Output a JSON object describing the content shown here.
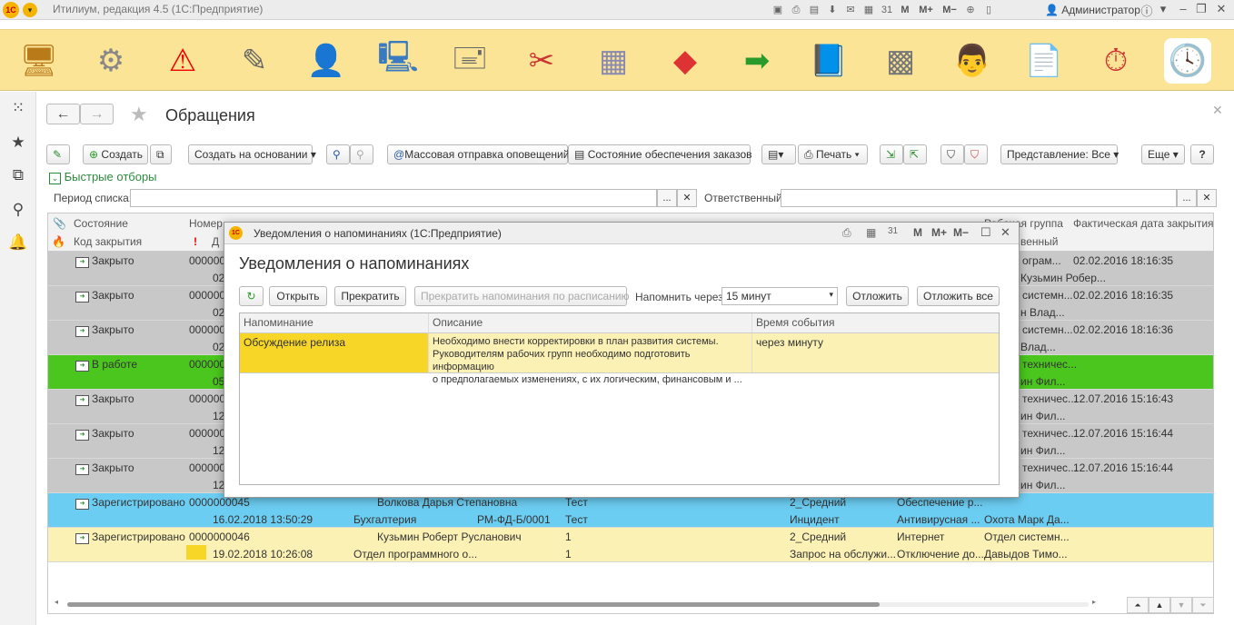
{
  "app": {
    "title": "Итилиум, редакция 4.5  (1С:Предприятие)",
    "user": "Администратор",
    "toolbar_icons": [
      "save-icon",
      "print-icon",
      "preview-icon",
      "download-icon",
      "mail-icon",
      "calendar-icon",
      "calendar31-icon"
    ],
    "memory_labels": {
      "m": "M",
      "mplus": "M+",
      "mminus": "M−"
    }
  },
  "sections": [
    "desktop-icon",
    "settings-icon",
    "warning-icon",
    "tools-icon",
    "contacts-icon",
    "computer-icon",
    "stamp-icon",
    "repair-icon",
    "cube-icon",
    "boxes-icon",
    "arrow-icon",
    "book-icon",
    "safe-icon",
    "finance-icon",
    "document-icon",
    "stopwatch-icon",
    "clock-icon"
  ],
  "page": {
    "title": "Обращения"
  },
  "toolbar": {
    "create": "Создать",
    "create_based": "Создать на основании",
    "mass_send": "Массовая отправка оповещений",
    "order_status": "Состояние обеспечения заказов",
    "print": "Печать",
    "view": "Представление: Все",
    "more": "Еще",
    "help": "?"
  },
  "filters": {
    "quick_filters": "Быстрые отборы",
    "period_label": "Период списка:",
    "responsible_label": "Ответственный:",
    "period_value": "",
    "responsible_value": ""
  },
  "grid": {
    "headers": {
      "status": "Состояние",
      "close_code": "Код закрытия",
      "number": "Номер",
      "date_short": "Д",
      "group": "Рабочая группа",
      "group_part": "венный",
      "close_date": "Фактическая дата закрытия"
    },
    "rows": [
      {
        "status": "Закрыто",
        "num": "000000",
        "sub": "02",
        "col1": "ограм...",
        "col2": "Кузьмин Робер...",
        "close": "02.02.2016 18:16:35",
        "color": "gray"
      },
      {
        "status": "Закрыто",
        "num": "000000",
        "sub": "02",
        "col1": "системн...",
        "col2": "н Влад...",
        "close": "02.02.2016 18:16:35",
        "color": "gray"
      },
      {
        "status": "Закрыто",
        "num": "000000",
        "sub": "02",
        "col1": "системн...",
        "col2": "Влад...",
        "close": "02.02.2016 18:16:36",
        "color": "gray"
      },
      {
        "status": "В работе",
        "num": "000000",
        "sub": "05",
        "col1": "техничес...",
        "col2": "ин Фил...",
        "close": "",
        "color": "green"
      },
      {
        "status": "Закрыто",
        "num": "000000",
        "sub": "12",
        "col1": "техничес...",
        "col2": "ин Фил...",
        "close": "12.07.2016 15:16:43",
        "color": "gray"
      },
      {
        "status": "Закрыто",
        "num": "000000",
        "sub": "12",
        "col1": "техничес...",
        "col2": "ин Фил...",
        "close": "12.07.2016 15:16:44",
        "color": "gray"
      },
      {
        "status": "Закрыто",
        "num": "000000",
        "sub": "12",
        "col1": "техничес...",
        "col2": "ин Фил...",
        "close": "12.07.2016 15:16:44",
        "color": "gray"
      }
    ],
    "blue_row": {
      "status": "Зарегистрировано",
      "num": "0000000045",
      "person": "Волкова Дарья Степановна",
      "subject": "Тест",
      "priority": "2_Средний",
      "service": "Обеспечение р...",
      "date": "16.02.2018 13:50:29",
      "dept": "Бухгалтерия",
      "workplace": "РМ-ФД-Б/0001",
      "desc": "Тест",
      "type": "Инцидент",
      "service2": "Антивирусная ...",
      "responsible": "Охота Марк Да..."
    },
    "yellow_row": {
      "status": "Зарегистрировано",
      "num": "0000000046",
      "person": "Кузьмин Роберт Русланович",
      "subject": "1",
      "priority": "2_Средний",
      "service": "Интернет",
      "group": "Отдел системн...",
      "date": "19.02.2018 10:26:08",
      "dept": "Отдел программного о...",
      "desc": "1",
      "type": "Запрос на обслужи...",
      "service2": "Отключение до...",
      "responsible": "Давыдов Тимо..."
    }
  },
  "dialog": {
    "window_title": "Уведомления о напоминаниях  (1С:Предприятие)",
    "heading": "Уведомления о напоминаниях",
    "open": "Открыть",
    "stop": "Прекратить",
    "stop_schedule": "Прекратить напоминания  по расписанию",
    "remind_label": "Напомнить через:",
    "remind_value": "15 минут",
    "postpone": "Отложить",
    "postpone_all": "Отложить все",
    "columns": {
      "reminder": "Напоминание",
      "description": "Описание",
      "event_time": "Время события"
    },
    "row": {
      "reminder": "Обсуждение релиза",
      "description_1": "Необходимо внести корректировки в план развития системы.",
      "description_2": "Руководителям рабочих групп необходимо подготовить информацию",
      "description_3": "о предполагаемых изменениях, с их логическим, финансовым и ...",
      "event_time": "через минуту"
    }
  }
}
